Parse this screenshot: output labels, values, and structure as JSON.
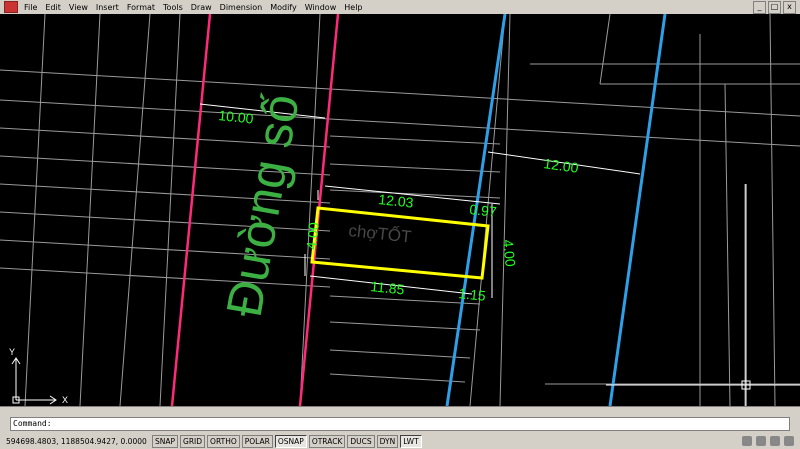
{
  "menu": [
    "File",
    "Edit",
    "View",
    "Insert",
    "Format",
    "Tools",
    "Draw",
    "Dimension",
    "Modify",
    "Window",
    "Help"
  ],
  "window_controls": {
    "minimize": "_",
    "restore": "□",
    "close": "x"
  },
  "drawing": {
    "street_label": "Đường số",
    "dim_road_width": "10.00",
    "dim_top": "12.03",
    "dim_top_right": "0.97",
    "dim_bottom": "11.85",
    "dim_bottom_right": "1.15",
    "dim_left": "4.00",
    "dim_right": "4.00",
    "dim_right_far": "12.00",
    "watermark": "chợTỐT",
    "ucs_x": "X",
    "ucs_y": "Y"
  },
  "command": {
    "prompt": "Command:"
  },
  "status": {
    "coords": "594698.4803, 1188504.9427, 0.0000",
    "toggles": [
      {
        "label": "SNAP",
        "on": false
      },
      {
        "label": "GRID",
        "on": false
      },
      {
        "label": "ORTHO",
        "on": false
      },
      {
        "label": "POLAR",
        "on": false
      },
      {
        "label": "OSNAP",
        "on": true
      },
      {
        "label": "OTRACK",
        "on": false
      },
      {
        "label": "DUCS",
        "on": false
      },
      {
        "label": "DYN",
        "on": false
      },
      {
        "label": "LWT",
        "on": true
      }
    ]
  },
  "colors": {
    "canvas": "#000000",
    "road_line": "#ff2a7a",
    "blue_line": "#2ea0e8",
    "dimension": "#22ff22",
    "lot": "#ffff00",
    "grid": "#9a9a9a"
  }
}
